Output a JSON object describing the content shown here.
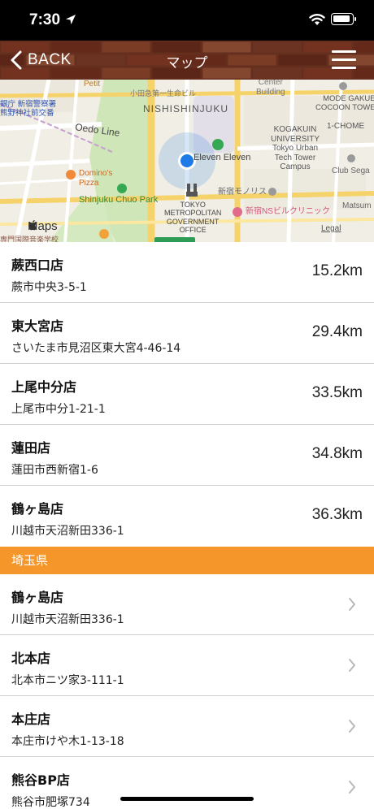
{
  "status_bar": {
    "time": "7:30"
  },
  "nav": {
    "back_label": "BACK",
    "title": "マップ"
  },
  "map": {
    "labels": {
      "petit": "Petit",
      "odakyu": "小田急第一生命ビル",
      "nishishinjuku": "NISHISHINJUKU",
      "center_building": "Center\nBuilding",
      "mode_gakuen": "MODE GAKUEN\nCOCOON TOWER",
      "ginko": "銀庁 新宿警察署\n熊野神社前交番",
      "oedo": "Oedo Line",
      "kogakuin": "KOGAKUIN\nUNIVERSITY\nTokyo Urban\nTech Tower\nCampus",
      "chome": "1-CHOME",
      "club_sega": "Club Sega",
      "eleven": "Eleven Eleven",
      "dominos": "Domino's\nPizza",
      "chuo_park": "Shinjuku Chuo Park",
      "monolith": "新宿モノリス",
      "metro_gov": "TOKYO\nMETROPOLITAN\nGOVERNMENT\nOFFICE",
      "ns_clinic": "新宿NSビルクリニック",
      "matsu": "Matsum",
      "maps_logo": "Maps",
      "bottom_left": "専門国際音楽学校",
      "legal": "Legal"
    }
  },
  "nearby": [
    {
      "name": "蕨西口店",
      "address": "蕨市中央3-5-1",
      "distance": "15.2km"
    },
    {
      "name": "東大宮店",
      "address": "さいたま市見沼区東大宮4-46-14",
      "distance": "29.4km"
    },
    {
      "name": "上尾中分店",
      "address": "上尾市中分1-21-1",
      "distance": "33.5km"
    },
    {
      "name": "蓮田店",
      "address": "蓮田市西新宿1-6",
      "distance": "34.8km"
    },
    {
      "name": "鶴ヶ島店",
      "address": "川越市天沼新田336-1",
      "distance": "36.3km"
    }
  ],
  "section": {
    "title": "埼玉県"
  },
  "stores": [
    {
      "name": "鶴ヶ島店",
      "address": "川越市天沼新田336-1"
    },
    {
      "name": "北本店",
      "address": "北本市ニツ家3-111-1"
    },
    {
      "name": "本庄店",
      "address": "本庄市けや木1-13-18"
    },
    {
      "name": "熊谷BP店",
      "address": "熊谷市肥塚734"
    }
  ],
  "colors": {
    "section_header": "#f5962b",
    "brick": "#7a3a25",
    "location_dot": "#1e7ae6"
  },
  "icons": [
    "location-arrow-icon",
    "wifi-icon",
    "battery-icon",
    "back-chevron-icon",
    "menu-icon",
    "chevron-right-icon",
    "apple-logo-icon"
  ]
}
